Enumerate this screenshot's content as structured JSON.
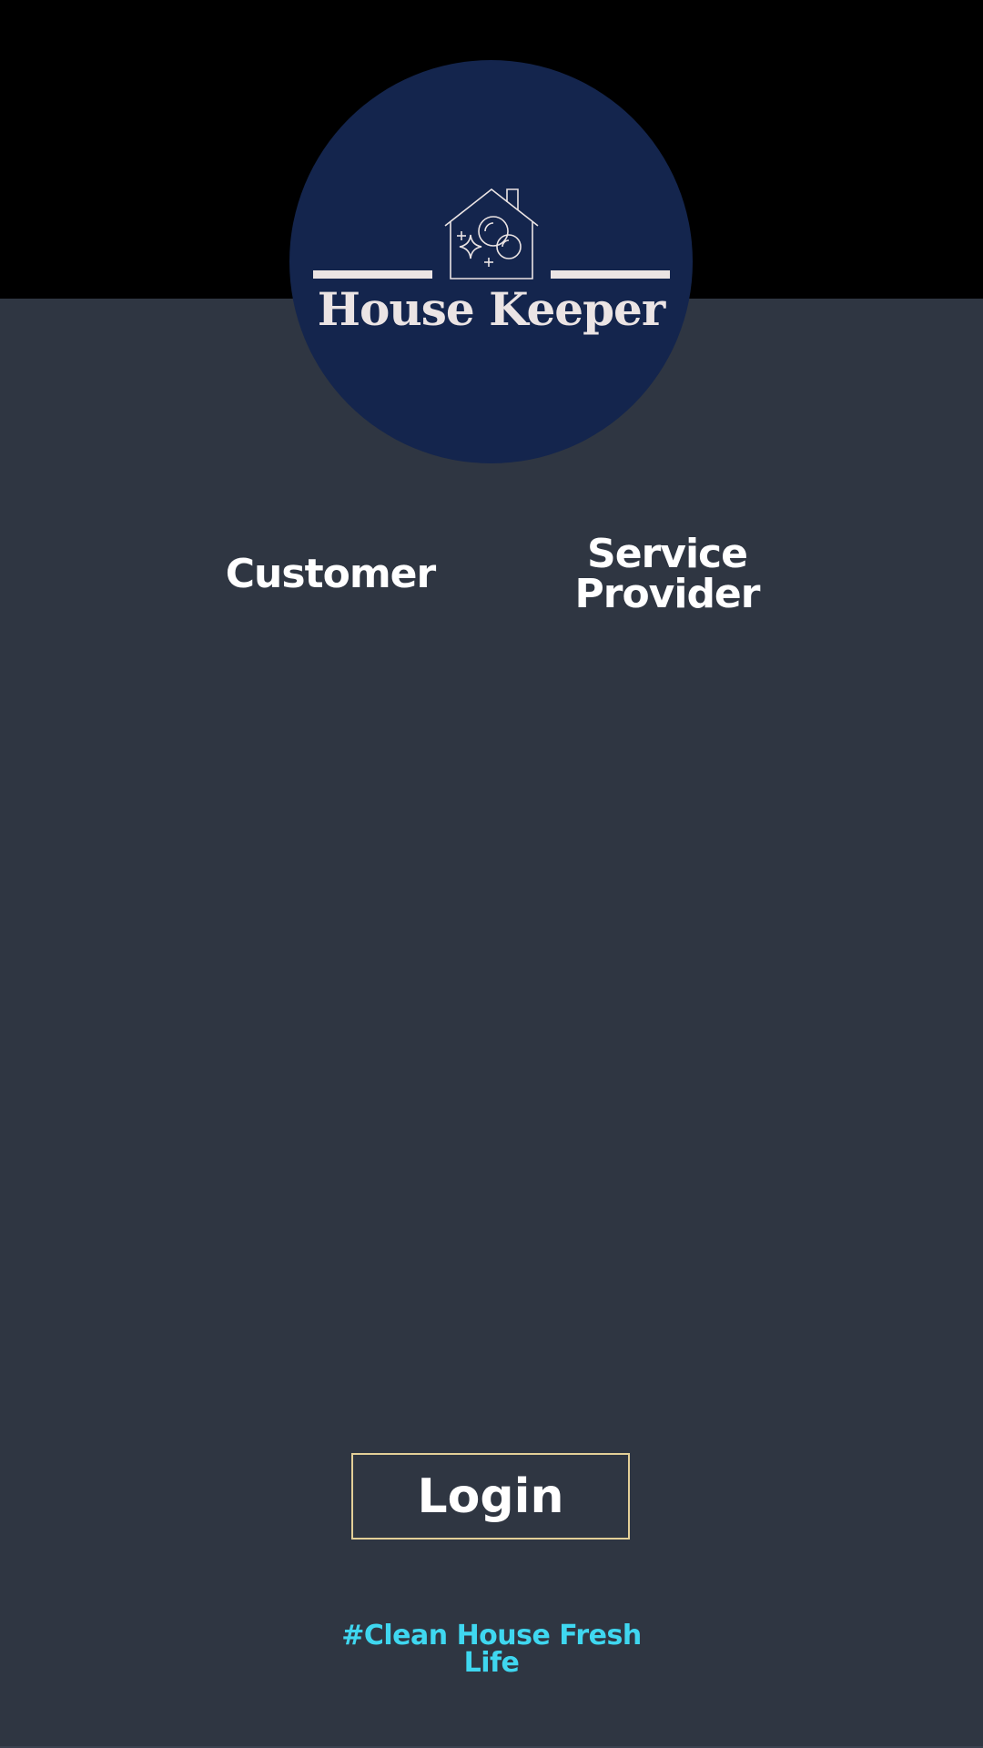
{
  "brand": {
    "name": "House Keeper",
    "logo_icon": "house-cleaning-icon"
  },
  "roles": {
    "customer_label": "Customer",
    "provider_label_line1": "Service",
    "provider_label_line2": "Provider"
  },
  "login": {
    "label": "Login"
  },
  "tagline": {
    "line1": "#Clean House Fresh",
    "line2": "Life"
  },
  "colors": {
    "background": "#2f3642",
    "top_band": "#000000",
    "logo_circle": "#14254d",
    "logo_text": "#ebe4e4",
    "login_border": "#e3cf97",
    "tagline": "#3fd7f0"
  }
}
